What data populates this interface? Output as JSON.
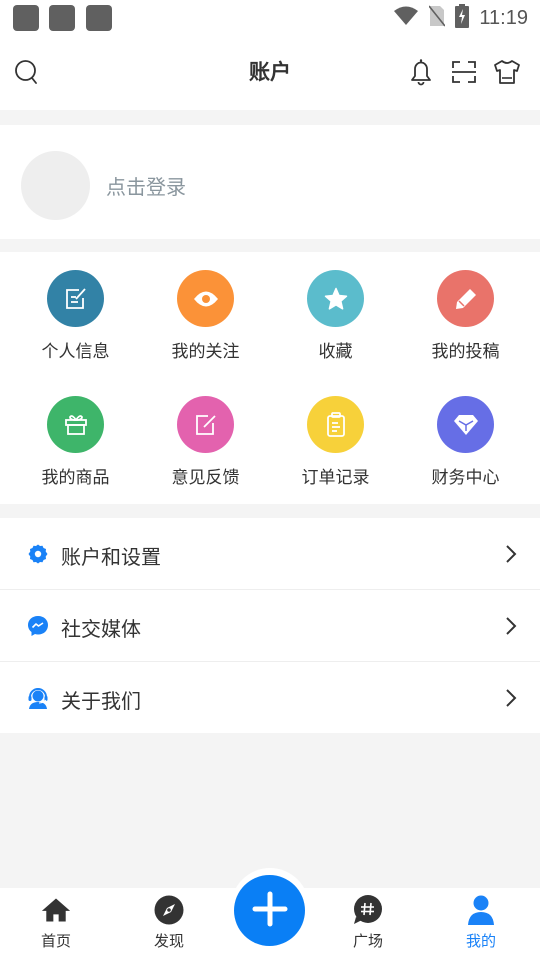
{
  "status_bar": {
    "time": "11:19",
    "icons": [
      "notification-icon",
      "notification-icon",
      "notification-icon",
      "wifi-icon",
      "no-sim-icon",
      "battery-charging-icon"
    ]
  },
  "header": {
    "title": "账户",
    "left_icon": "search-icon",
    "right_icons": [
      "bell-icon",
      "scan-icon",
      "tshirt-icon"
    ]
  },
  "login": {
    "prompt": "点击登录"
  },
  "grid": {
    "items": [
      {
        "label": "个人信息",
        "icon": "edit-document-icon",
        "color": "#3282a6"
      },
      {
        "label": "我的关注",
        "icon": "eye-icon",
        "color": "#fb9238"
      },
      {
        "label": "收藏",
        "icon": "star-icon",
        "color": "#5bbccc"
      },
      {
        "label": "我的投稿",
        "icon": "pencil-icon",
        "color": "#e9736a"
      },
      {
        "label": "我的商品",
        "icon": "gift-icon",
        "color": "#3eb56a"
      },
      {
        "label": "意见反馈",
        "icon": "feedback-edit-icon",
        "color": "#e362ae"
      },
      {
        "label": "订单记录",
        "icon": "clipboard-icon",
        "color": "#f7d13a"
      },
      {
        "label": "财务中心",
        "icon": "diamond-icon",
        "color": "#666ee6"
      }
    ]
  },
  "menu": {
    "accent": "#1a82f7",
    "items": [
      {
        "label": "账户和设置",
        "icon": "gear-icon"
      },
      {
        "label": "社交媒体",
        "icon": "messenger-icon"
      },
      {
        "label": "关于我们",
        "icon": "support-agent-icon"
      }
    ]
  },
  "bottom_nav": {
    "active_color": "#1a82f7",
    "fab_icon": "plus-icon",
    "items": [
      {
        "label": "首页",
        "icon": "home-icon",
        "active": false
      },
      {
        "label": "发现",
        "icon": "compass-icon",
        "active": false
      },
      {
        "label": "广场",
        "icon": "hashtag-chat-icon",
        "active": false
      },
      {
        "label": "我的",
        "icon": "person-icon",
        "active": true
      }
    ]
  }
}
